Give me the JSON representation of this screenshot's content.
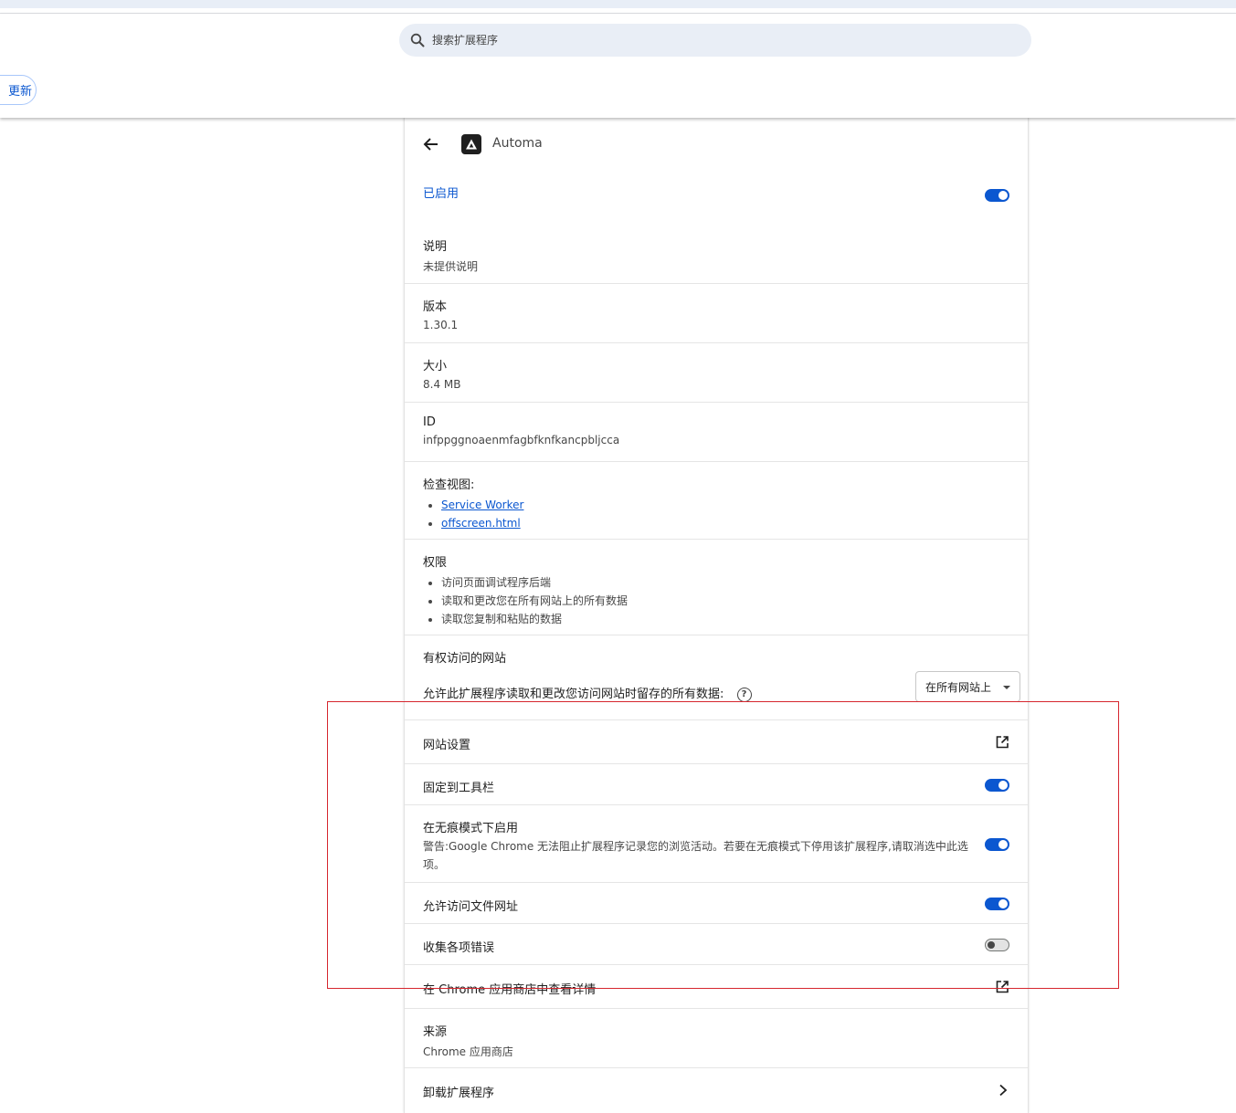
{
  "toolbar": {
    "search_placeholder": "搜索扩展程序",
    "update_label": "更新"
  },
  "extension": {
    "name": "Automa",
    "enabled_label": "已启用",
    "enabled": true,
    "description_label": "说明",
    "description_value": "未提供说明",
    "version_label": "版本",
    "version_value": "1.30.1",
    "size_label": "大小",
    "size_value": "8.4 MB",
    "id_label": "ID",
    "id_value": "infppggnoaenmfagbfknfkancpbljcca",
    "views_label": "检查视图:",
    "views": [
      "Service Worker",
      "offscreen.html"
    ],
    "permissions_label": "权限",
    "permissions": [
      "访问页面调试程序后端",
      "读取和更改您在所有网站上的所有数据",
      "读取您复制和粘贴的数据"
    ],
    "site_access_label": "有权访问的网站",
    "site_access_desc": "允许此扩展程序读取和更改您访问网站时留存的所有数据:",
    "site_access_select": "在所有网站上",
    "site_settings_label": "网站设置",
    "pin_toolbar_label": "固定到工具栏",
    "pin_toolbar": true,
    "incognito_label": "在无痕模式下启用",
    "incognito_warning": "警告:Google Chrome 无法阻止扩展程序记录您的浏览活动。若要在无痕模式下停用该扩展程序,请取消选中此选项。",
    "incognito": true,
    "file_urls_label": "允许访问文件网址",
    "file_urls": true,
    "collect_errors_label": "收集各项错误",
    "collect_errors": false,
    "webstore_label": "在 Chrome 应用商店中查看详情",
    "source_label": "来源",
    "source_value": "Chrome 应用商店",
    "uninstall_label": "卸载扩展程序"
  },
  "colors": {
    "accent": "#0b57d0",
    "highlight_box": "#d6262e"
  },
  "icons": {
    "search": "search-icon",
    "back": "arrow-back-icon",
    "logo": "automa-logo-icon",
    "help": "help-circle-icon",
    "external": "open-in-new-icon",
    "chevron": "chevron-right-icon"
  }
}
